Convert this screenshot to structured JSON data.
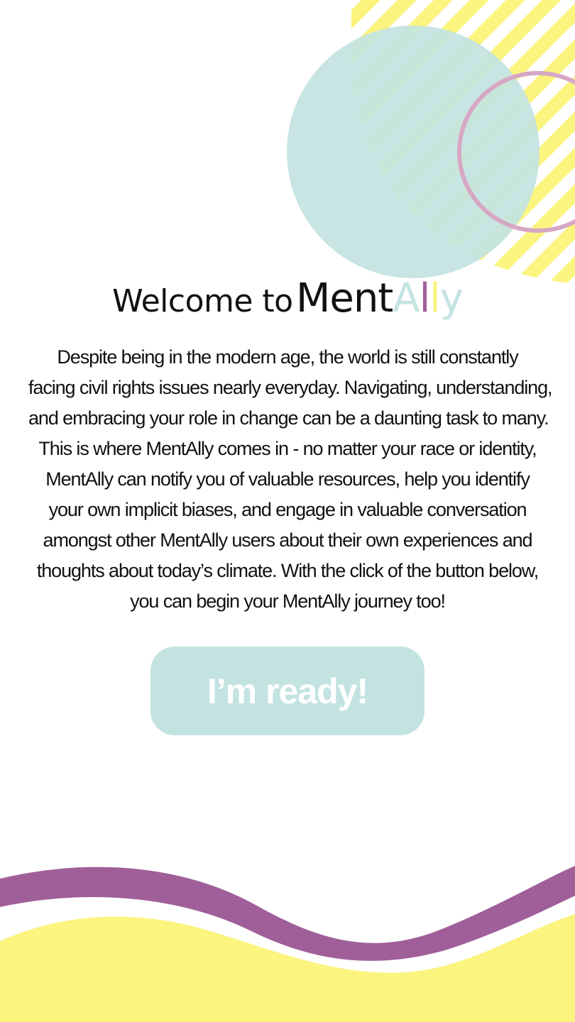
{
  "colors": {
    "teal": "#c3e3e1",
    "yellow": "#fbf47f",
    "purple": "#a05f99",
    "pink": "#d6a7c4",
    "text": "#111111",
    "button_text": "#ffffff"
  },
  "header": {
    "welcome_prefix": "Welcome to",
    "brand_parts": [
      {
        "text": "Ment",
        "color": "#111111"
      },
      {
        "text": "A",
        "color": "#c3e3e1"
      },
      {
        "text": "l",
        "color": "#a05f99"
      },
      {
        "text": "l",
        "color": "#fbf47f"
      },
      {
        "text": "y",
        "color": "#c3e3e1"
      }
    ]
  },
  "intro": {
    "lines": [
      "Despite being in the modern age, the world is still constantly",
      "facing civil rights issues nearly everyday. Navigating, understanding,",
      "and embracing your role in change can be a daunting task to many.",
      "This is where MentAlly comes in - no matter your race or identity,",
      "MentAlly can notify you of valuable resources, help you identify",
      "your own implicit biases, and engage in valuable conversation",
      "amongst other MentAlly users about their own experiences and",
      "thoughts about today’s climate. With the click of the button below,",
      "you can begin your MentAlly journey too!"
    ]
  },
  "cta": {
    "label": "I’m ready!"
  }
}
